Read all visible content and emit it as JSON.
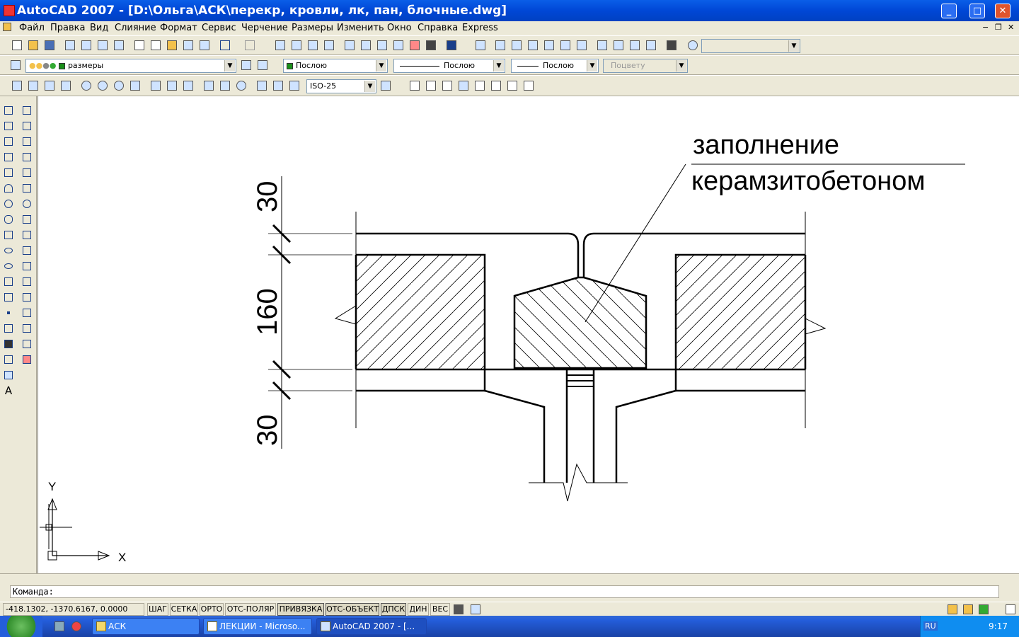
{
  "window": {
    "title": "AutoCAD 2007 - [D:\\Ольга\\АСК\\перекр, кровли, лк, пан, блочные.dwg]",
    "buttons": {
      "minimize": "_",
      "maximize": "□",
      "close": "✕"
    }
  },
  "menu": [
    "Файл",
    "Правка",
    "Вид",
    "Слияние",
    "Формат",
    "Сервис",
    "Черчение",
    "Размеры",
    "Изменить",
    "Окно",
    "Справка",
    "Express"
  ],
  "properties_bar": {
    "layer": "размеры",
    "color": "Послою",
    "linetype": "Послою",
    "lineweight": "Послою",
    "plotstyle": "Поцвету"
  },
  "dim_style": "ISO-25",
  "drawing": {
    "label_line1": "заполнение",
    "label_line2": "керамзитобетоном",
    "dim_top": "30",
    "dim_middle": "160",
    "dim_bottom": "30",
    "ucs_x": "X",
    "ucs_y": "Y"
  },
  "command": {
    "prompt": "Команда:"
  },
  "status": {
    "coords": "-418.1302, -1370.6167, 0.0000",
    "toggles": [
      {
        "label": "ШАГ",
        "on": false
      },
      {
        "label": "СЕТКА",
        "on": false
      },
      {
        "label": "ОРТО",
        "on": false
      },
      {
        "label": "ОТС-ПОЛЯР",
        "on": false
      },
      {
        "label": "ПРИВЯЗКА",
        "on": true
      },
      {
        "label": "ОТС-ОБЪЕКТ",
        "on": true
      },
      {
        "label": "ДПСК",
        "on": true
      },
      {
        "label": "ДИН",
        "on": false
      },
      {
        "label": "ВЕС",
        "on": false
      }
    ]
  },
  "taskbar": {
    "tasks": [
      {
        "label": "АСК",
        "active": false
      },
      {
        "label": "ЛЕКЦИИ - Microso...",
        "active": false
      },
      {
        "label": "AutoCAD 2007 - [...",
        "active": true
      }
    ],
    "language": "RU",
    "clock": "9:17"
  }
}
